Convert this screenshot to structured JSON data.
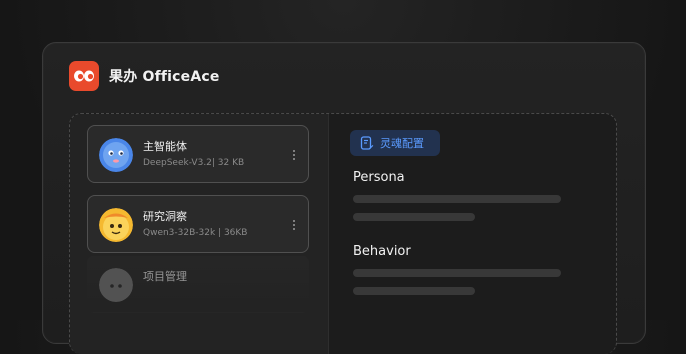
{
  "app": {
    "title": "果办 OfficeAce"
  },
  "agents": [
    {
      "name": "主智能体",
      "meta": "DeepSeek-V3.2| 32 KB",
      "avatar": "blue-blob-avatar"
    },
    {
      "name": "研究洞察",
      "meta": "Qwen3-32B-32k | 36KB",
      "avatar": "yellow-blob-avatar"
    },
    {
      "name": "项目管理",
      "meta": "",
      "avatar": "gray-blob-avatar"
    }
  ],
  "panel": {
    "tag_label": "灵魂配置",
    "sections": [
      {
        "title": "Persona"
      },
      {
        "title": "Behavior"
      }
    ]
  },
  "colors": {
    "accent": "#5b9bff",
    "logo": "#e94a2c",
    "tag_bg": "#22324f"
  }
}
